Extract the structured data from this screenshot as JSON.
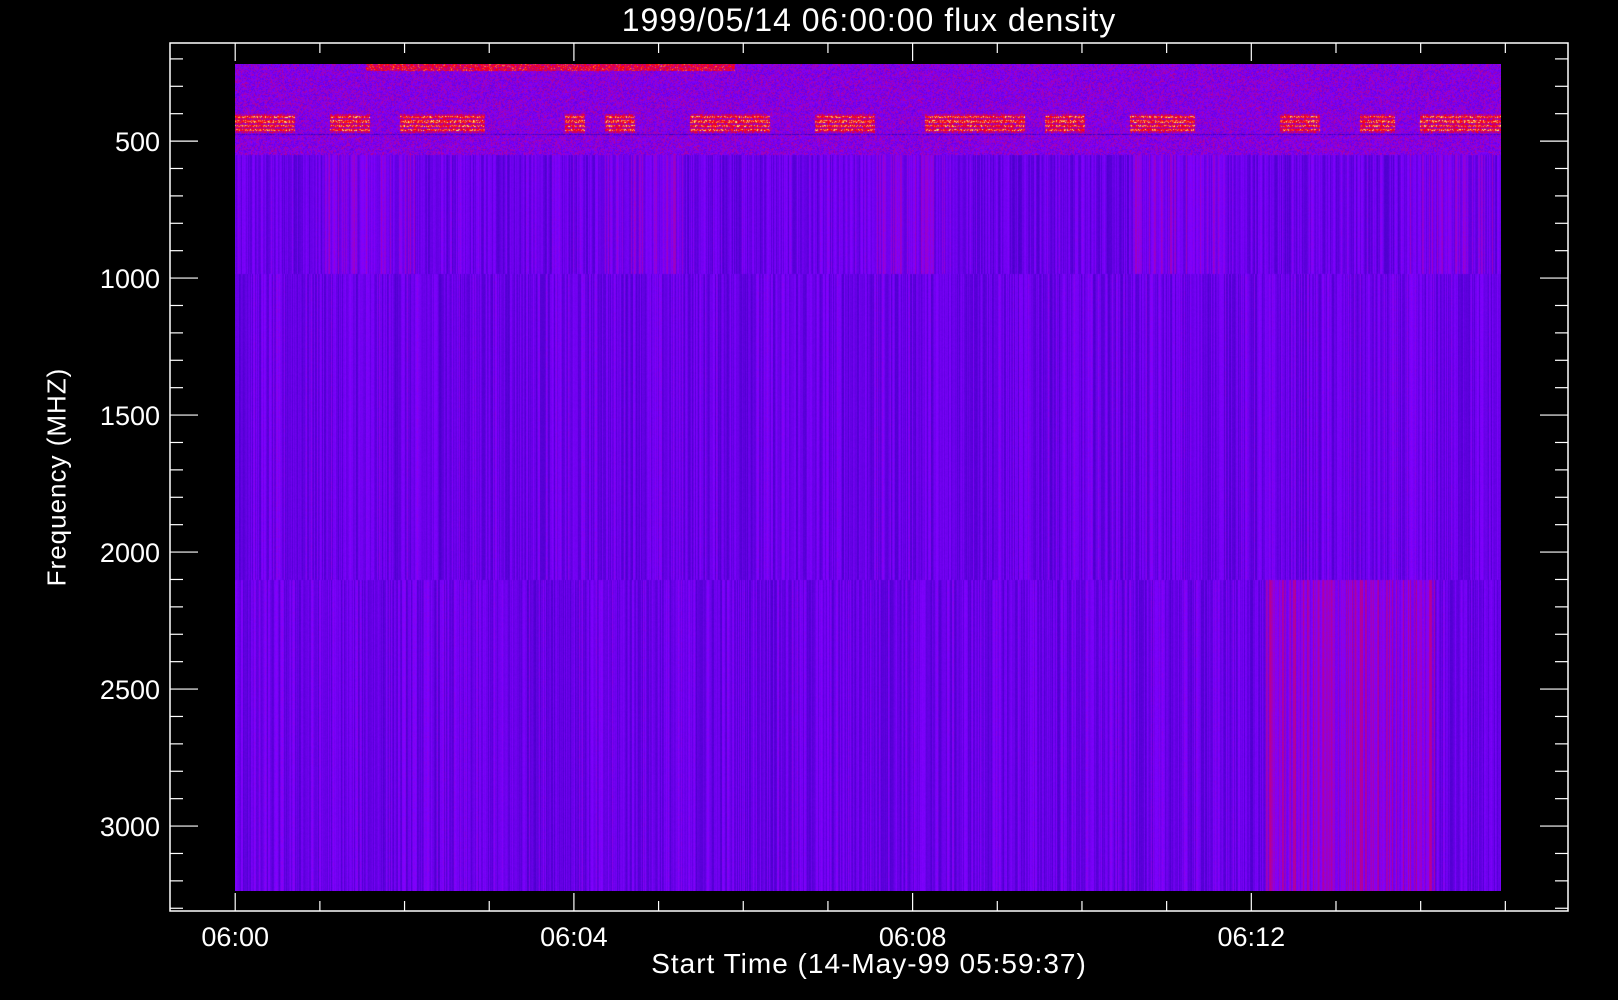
{
  "chart_data": {
    "type": "heatmap",
    "title": "1999/05/14 06:00:00 flux density",
    "xlabel": "Start Time (14-May-99 05:59:37)",
    "ylabel": "Frequency (MHZ)",
    "x_unit": "minutes after 06:00",
    "x_range": [
      0,
      15
    ],
    "xlim": [
      -0.77,
      15.74
    ],
    "x_major_ticks": [
      0,
      4,
      8,
      12
    ],
    "x_tick_labels": [
      "06:00",
      "06:04",
      "06:08",
      "06:12"
    ],
    "x_minor_step": 1,
    "y_range": [
      220,
      3237
    ],
    "ylim": [
      142,
      3310
    ],
    "y_reversed": true,
    "y_major_ticks": [
      500,
      1000,
      1500,
      2000,
      2500,
      3000
    ],
    "y_tick_labels": [
      "500",
      "1000",
      "1500",
      "2000",
      "2500",
      "3000"
    ],
    "y_minor_step": 100,
    "frequency_bands_mhz": [
      [
        220,
        551
      ],
      [
        551,
        985
      ],
      [
        985,
        2105
      ],
      [
        2105,
        3237
      ]
    ],
    "colormap": [
      "#000080",
      "#0000ff",
      "#8000a0",
      "#ff0000",
      "#ffff80"
    ],
    "grid": false
  }
}
